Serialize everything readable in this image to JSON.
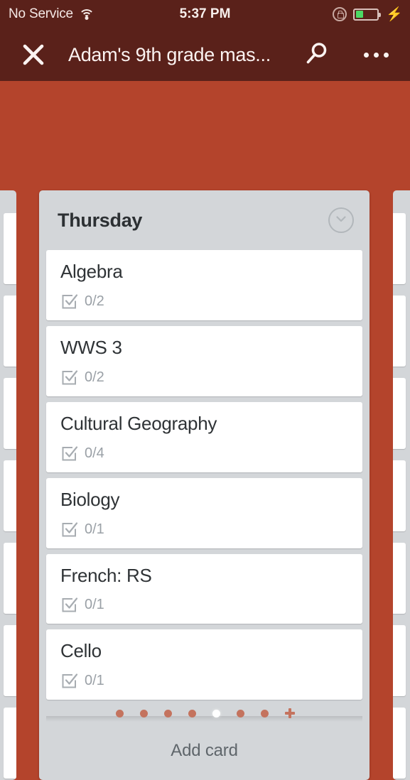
{
  "status_bar": {
    "carrier": "No Service",
    "wifi_icon": "wifi-icon",
    "time": "5:37 PM",
    "rotation_lock_icon": "rotation-lock-icon",
    "battery_percent": 35,
    "battery_color": "#4cd964",
    "charging_icon": "lightning-bolt-icon"
  },
  "app_bar": {
    "close_icon": "close-icon",
    "title": "Adam's 9th grade mas...",
    "search_icon": "search-icon",
    "overflow_icon": "overflow-menu-icon",
    "background": "#5a211a"
  },
  "board": {
    "background": "#b4442c",
    "list_background": "#d3d6d9",
    "card_background": "#ffffff"
  },
  "list": {
    "title": "Thursday",
    "menu_icon": "chevron-down-circle-icon",
    "add_card_label": "Add card",
    "cards": [
      {
        "title": "Algebra",
        "checklist_icon": "checklist-icon",
        "checklist": "0/2"
      },
      {
        "title": "WWS 3",
        "checklist_icon": "checklist-icon",
        "checklist": "0/2"
      },
      {
        "title": "Cultural Geography",
        "checklist_icon": "checklist-icon",
        "checklist": "0/4"
      },
      {
        "title": "Biology",
        "checklist_icon": "checklist-icon",
        "checklist": "0/1"
      },
      {
        "title": "French: RS",
        "checklist_icon": "checklist-icon",
        "checklist": "0/1"
      },
      {
        "title": "Cello",
        "checklist_icon": "checklist-icon",
        "checklist": "0/1"
      }
    ]
  },
  "pager": {
    "total": 7,
    "active_index": 4,
    "add_list_icon": "plus-icon"
  }
}
